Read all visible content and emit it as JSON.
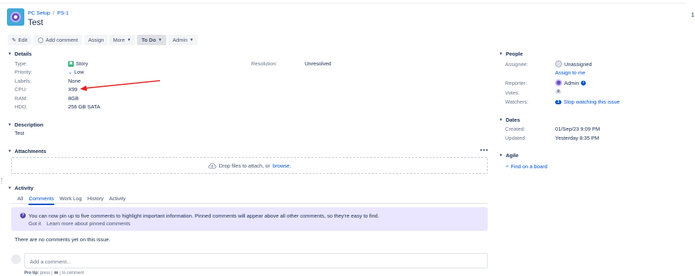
{
  "page": {
    "right_number": "1"
  },
  "breadcrumb": {
    "project": "PC Setup",
    "separator": "/",
    "issue_key": "PS-1"
  },
  "issue": {
    "title": "Test"
  },
  "toolbar": {
    "edit": "Edit",
    "add_comment": "Add comment",
    "assign": "Assign",
    "more": "More",
    "status": "To Do",
    "admin": "Admin"
  },
  "details": {
    "heading": "Details",
    "fields": [
      {
        "label": "Type:",
        "value": "Story"
      },
      {
        "label": "Priority:",
        "value": "Low"
      },
      {
        "label": "Labels:",
        "value": "None"
      },
      {
        "label": "CPU:",
        "value": "X99"
      },
      {
        "label": "RAM:",
        "value": "8GB"
      },
      {
        "label": "HDD:",
        "value": "256 GB SATA"
      }
    ],
    "resolution_label": "Resolution:",
    "resolution_value": "Unresolved"
  },
  "description": {
    "heading": "Description",
    "text": "Test"
  },
  "attachments": {
    "heading": "Attachments",
    "more": "•••",
    "drop_text": "Drop files to attach, or",
    "browse": "browse."
  },
  "activity": {
    "heading": "Activity",
    "tabs": [
      "All",
      "Comments",
      "Work Log",
      "History",
      "Activity"
    ],
    "active_tab": "Comments",
    "info_text": "You can now pin up to five comments to highlight important information. Pinned comments will appear above all other comments, so they're easy to find.",
    "got_it": "Got it",
    "learn_more": "Learn more about pinned comments",
    "no_comments": "There are no comments yet on this issue.",
    "comment_placeholder": "Add a comment...",
    "protip_prefix": "Pro tip:",
    "protip_press": "press",
    "protip_key": "m",
    "protip_suffix": "to comment"
  },
  "people": {
    "heading": "People",
    "assignee_label": "Assignee:",
    "assignee_value": "Unassigned",
    "assign_to_me": "Assign to me",
    "reporter_label": "Reporter:",
    "reporter_value": "Admin",
    "votes_label": "Votes:",
    "votes_value": "0",
    "watchers_label": "Watchers:",
    "watchers_count": "1",
    "watchers_action": "Stop watching this issue"
  },
  "dates": {
    "heading": "Dates",
    "created_label": "Created:",
    "created_value": "01/Sep/23 9:09 PM",
    "updated_label": "Updated:",
    "updated_value": "Yesterday 8:35 PM"
  },
  "agile": {
    "heading": "Agile",
    "link": "Find on a board"
  },
  "colors": {
    "link": "#0052cc",
    "story": "#36b37e",
    "arrow": "#e02020",
    "info_bg": "#eae6ff"
  }
}
